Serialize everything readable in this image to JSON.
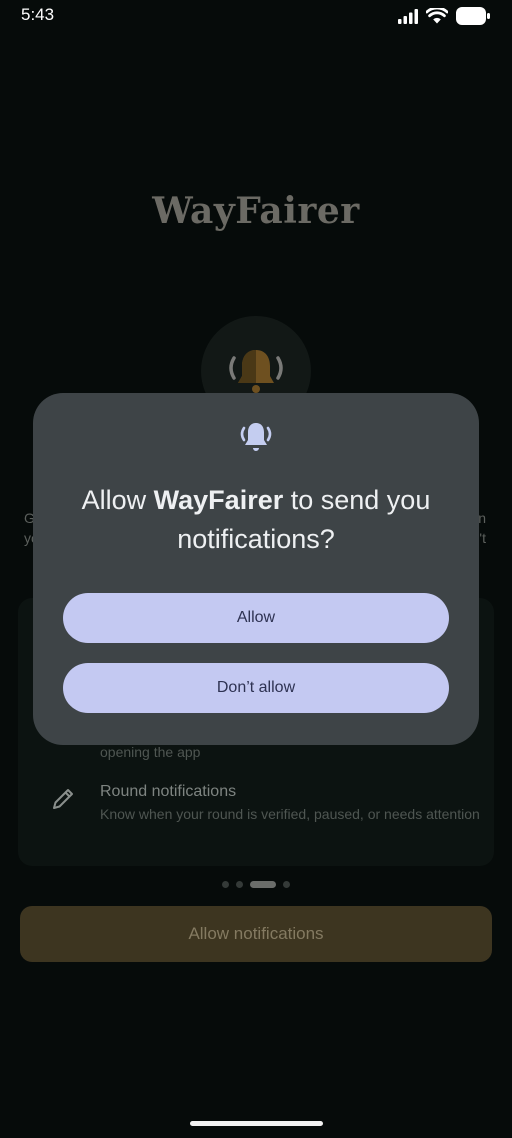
{
  "status_bar": {
    "time": "5:43",
    "icons": [
      "signal-icon",
      "wifi-icon",
      "battery-icon"
    ]
  },
  "app": {
    "logo_text": "WayFairer",
    "hero_icon": "bell-ringing-icon",
    "intro_left_fragments": [
      "G",
      "yo"
    ],
    "intro_right_fragments": [
      "n",
      "n't"
    ],
    "features": [
      {
        "icon": "bell-icon",
        "description_visible": "opening the app"
      },
      {
        "icon": "pencil-icon",
        "title": "Round notifications",
        "description": "Know when your round is verified, paused, or needs attention"
      }
    ],
    "pager": {
      "count": 4,
      "active_index": 2
    },
    "cta_label": "Allow notifications"
  },
  "dialog": {
    "icon": "bell-ringing-icon",
    "title_prefix": "Allow ",
    "title_app_name": "WayFairer",
    "title_suffix": " to send you notifications?",
    "allow_label": "Allow",
    "deny_label": "Don’t allow"
  },
  "colors": {
    "background": "#060b0a",
    "dialog_background": "#3e4447",
    "dialog_button": "#c4c9f2",
    "cta_background": "#3d3520",
    "accent_bell": "#c4cdf0"
  }
}
